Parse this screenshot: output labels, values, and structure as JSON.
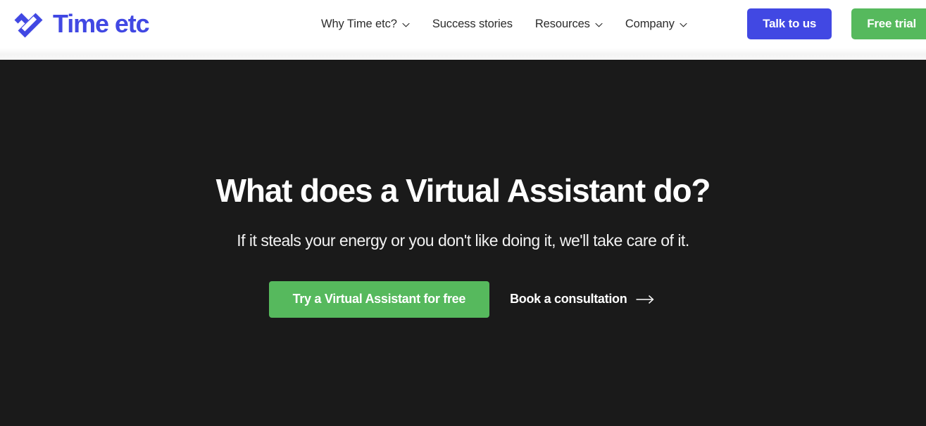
{
  "header": {
    "logo": {
      "mark_icon": "check-diamond-logo-icon",
      "wordmark": "Time etc",
      "brand_color": "#4148e3"
    },
    "nav": [
      {
        "label": "Why Time etc?",
        "has_dropdown": true,
        "icon": "chevron-down-icon"
      },
      {
        "label": "Success stories",
        "has_dropdown": false,
        "icon": ""
      },
      {
        "label": "Resources",
        "has_dropdown": true,
        "icon": "chevron-down-icon"
      },
      {
        "label": "Company",
        "has_dropdown": true,
        "icon": "chevron-down-icon"
      }
    ],
    "actions": {
      "talk_label": "Talk to us",
      "talk_color": "#4148e3",
      "trial_label": "Free trial",
      "trial_color": "#56b95d"
    }
  },
  "hero": {
    "background_color": "#1a1a1a",
    "title": "What does a Virtual Assistant do?",
    "subtitle": "If it steals your energy or you don't like doing it, we'll take care of it.",
    "primary_cta": {
      "label": "Try a Virtual Assistant for free",
      "color": "#56b95d"
    },
    "secondary_cta": {
      "label": "Book a consultation",
      "icon": "arrow-right-icon"
    }
  }
}
